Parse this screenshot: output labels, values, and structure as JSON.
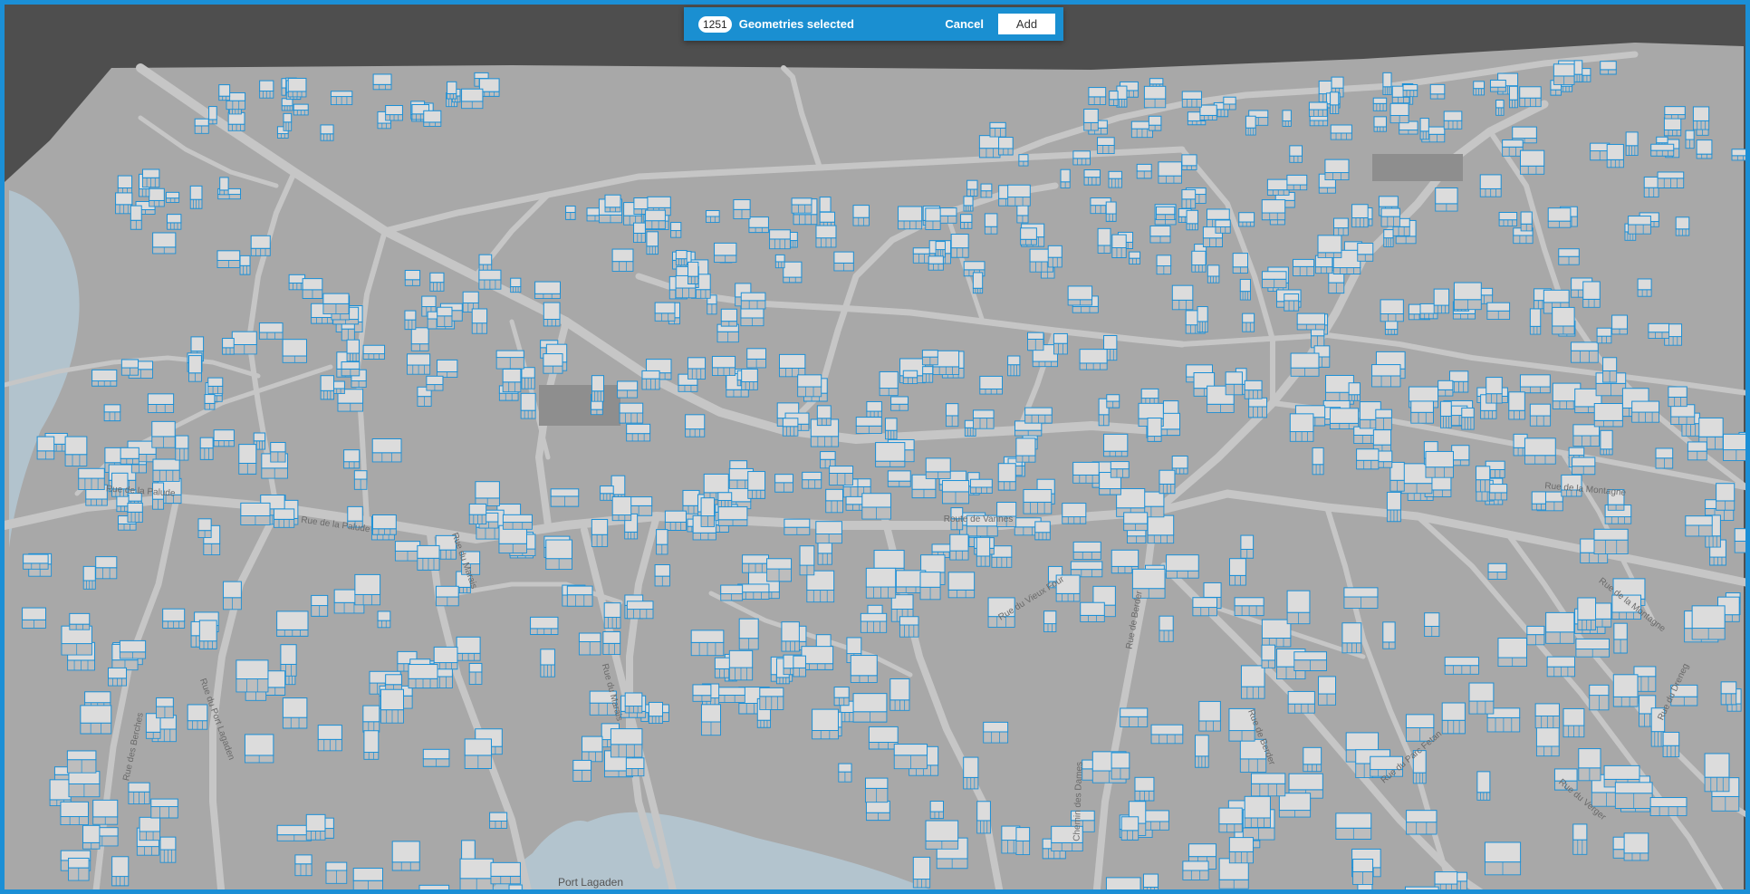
{
  "toolbar": {
    "count": "1251",
    "selection_label": "Geometries selected",
    "cancel_label": "Cancel",
    "add_label": "Add"
  },
  "map": {
    "selection_color": "#1b8fd6",
    "terrain_color": "#a9a9a9",
    "road_color": "#c6c6c6",
    "water_color": "#b3c4ce",
    "street_labels": [
      {
        "id": "rue-de-la-palude-1",
        "text": "Rue de la Palude"
      },
      {
        "id": "rue-de-la-palude-2",
        "text": "Rue de la Palude"
      },
      {
        "id": "rue-du-marais-1",
        "text": "Rue du Marais"
      },
      {
        "id": "rue-du-marais-2",
        "text": "Rue du Marais"
      },
      {
        "id": "route-de-vannes",
        "text": "Route de Vannes"
      },
      {
        "id": "rue-du-vieux-four",
        "text": "Rue du Vieux Four"
      },
      {
        "id": "rue-de-berder-1",
        "text": "Rue de Berder"
      },
      {
        "id": "rue-de-berder-2",
        "text": "Rue de Berder"
      },
      {
        "id": "chemin-des-dames",
        "text": "Chemin des Dames"
      },
      {
        "id": "rue-du-parc-fetan",
        "text": "Rue du Parc Fetan"
      },
      {
        "id": "rue-du-verger",
        "text": "Rue du Verger"
      },
      {
        "id": "rue-de-la-montagne-1",
        "text": "Rue de la Montagne"
      },
      {
        "id": "rue-de-la-montagne-2",
        "text": "Rue de la Montagne"
      },
      {
        "id": "rue-du-port-lagaden",
        "text": "Rue du Port Lagaden"
      },
      {
        "id": "rue-des-berches",
        "text": "Rue des Berches"
      },
      {
        "id": "rue-du-dreneg",
        "text": "Rue du Dreneg"
      }
    ],
    "place_labels": [
      {
        "id": "port-lagaden",
        "text": "Port Lagaden"
      }
    ]
  }
}
